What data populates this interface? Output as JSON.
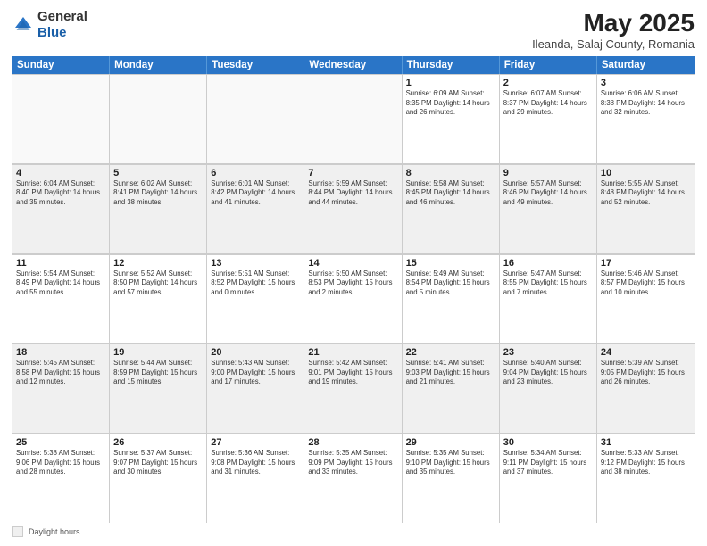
{
  "header": {
    "logo_general": "General",
    "logo_blue": "Blue",
    "title": "May 2025",
    "subtitle": "Ileanda, Salaj County, Romania"
  },
  "calendar": {
    "days_of_week": [
      "Sunday",
      "Monday",
      "Tuesday",
      "Wednesday",
      "Thursday",
      "Friday",
      "Saturday"
    ],
    "weeks": [
      [
        {
          "day": "",
          "info": "",
          "empty": true
        },
        {
          "day": "",
          "info": "",
          "empty": true
        },
        {
          "day": "",
          "info": "",
          "empty": true
        },
        {
          "day": "",
          "info": "",
          "empty": true
        },
        {
          "day": "1",
          "info": "Sunrise: 6:09 AM\nSunset: 8:35 PM\nDaylight: 14 hours and 26 minutes.",
          "empty": false
        },
        {
          "day": "2",
          "info": "Sunrise: 6:07 AM\nSunset: 8:37 PM\nDaylight: 14 hours and 29 minutes.",
          "empty": false
        },
        {
          "day": "3",
          "info": "Sunrise: 6:06 AM\nSunset: 8:38 PM\nDaylight: 14 hours and 32 minutes.",
          "empty": false
        }
      ],
      [
        {
          "day": "4",
          "info": "Sunrise: 6:04 AM\nSunset: 8:40 PM\nDaylight: 14 hours and 35 minutes.",
          "empty": false
        },
        {
          "day": "5",
          "info": "Sunrise: 6:02 AM\nSunset: 8:41 PM\nDaylight: 14 hours and 38 minutes.",
          "empty": false
        },
        {
          "day": "6",
          "info": "Sunrise: 6:01 AM\nSunset: 8:42 PM\nDaylight: 14 hours and 41 minutes.",
          "empty": false
        },
        {
          "day": "7",
          "info": "Sunrise: 5:59 AM\nSunset: 8:44 PM\nDaylight: 14 hours and 44 minutes.",
          "empty": false
        },
        {
          "day": "8",
          "info": "Sunrise: 5:58 AM\nSunset: 8:45 PM\nDaylight: 14 hours and 46 minutes.",
          "empty": false
        },
        {
          "day": "9",
          "info": "Sunrise: 5:57 AM\nSunset: 8:46 PM\nDaylight: 14 hours and 49 minutes.",
          "empty": false
        },
        {
          "day": "10",
          "info": "Sunrise: 5:55 AM\nSunset: 8:48 PM\nDaylight: 14 hours and 52 minutes.",
          "empty": false
        }
      ],
      [
        {
          "day": "11",
          "info": "Sunrise: 5:54 AM\nSunset: 8:49 PM\nDaylight: 14 hours and 55 minutes.",
          "empty": false
        },
        {
          "day": "12",
          "info": "Sunrise: 5:52 AM\nSunset: 8:50 PM\nDaylight: 14 hours and 57 minutes.",
          "empty": false
        },
        {
          "day": "13",
          "info": "Sunrise: 5:51 AM\nSunset: 8:52 PM\nDaylight: 15 hours and 0 minutes.",
          "empty": false
        },
        {
          "day": "14",
          "info": "Sunrise: 5:50 AM\nSunset: 8:53 PM\nDaylight: 15 hours and 2 minutes.",
          "empty": false
        },
        {
          "day": "15",
          "info": "Sunrise: 5:49 AM\nSunset: 8:54 PM\nDaylight: 15 hours and 5 minutes.",
          "empty": false
        },
        {
          "day": "16",
          "info": "Sunrise: 5:47 AM\nSunset: 8:55 PM\nDaylight: 15 hours and 7 minutes.",
          "empty": false
        },
        {
          "day": "17",
          "info": "Sunrise: 5:46 AM\nSunset: 8:57 PM\nDaylight: 15 hours and 10 minutes.",
          "empty": false
        }
      ],
      [
        {
          "day": "18",
          "info": "Sunrise: 5:45 AM\nSunset: 8:58 PM\nDaylight: 15 hours and 12 minutes.",
          "empty": false
        },
        {
          "day": "19",
          "info": "Sunrise: 5:44 AM\nSunset: 8:59 PM\nDaylight: 15 hours and 15 minutes.",
          "empty": false
        },
        {
          "day": "20",
          "info": "Sunrise: 5:43 AM\nSunset: 9:00 PM\nDaylight: 15 hours and 17 minutes.",
          "empty": false
        },
        {
          "day": "21",
          "info": "Sunrise: 5:42 AM\nSunset: 9:01 PM\nDaylight: 15 hours and 19 minutes.",
          "empty": false
        },
        {
          "day": "22",
          "info": "Sunrise: 5:41 AM\nSunset: 9:03 PM\nDaylight: 15 hours and 21 minutes.",
          "empty": false
        },
        {
          "day": "23",
          "info": "Sunrise: 5:40 AM\nSunset: 9:04 PM\nDaylight: 15 hours and 23 minutes.",
          "empty": false
        },
        {
          "day": "24",
          "info": "Sunrise: 5:39 AM\nSunset: 9:05 PM\nDaylight: 15 hours and 26 minutes.",
          "empty": false
        }
      ],
      [
        {
          "day": "25",
          "info": "Sunrise: 5:38 AM\nSunset: 9:06 PM\nDaylight: 15 hours and 28 minutes.",
          "empty": false
        },
        {
          "day": "26",
          "info": "Sunrise: 5:37 AM\nSunset: 9:07 PM\nDaylight: 15 hours and 30 minutes.",
          "empty": false
        },
        {
          "day": "27",
          "info": "Sunrise: 5:36 AM\nSunset: 9:08 PM\nDaylight: 15 hours and 31 minutes.",
          "empty": false
        },
        {
          "day": "28",
          "info": "Sunrise: 5:35 AM\nSunset: 9:09 PM\nDaylight: 15 hours and 33 minutes.",
          "empty": false
        },
        {
          "day": "29",
          "info": "Sunrise: 5:35 AM\nSunset: 9:10 PM\nDaylight: 15 hours and 35 minutes.",
          "empty": false
        },
        {
          "day": "30",
          "info": "Sunrise: 5:34 AM\nSunset: 9:11 PM\nDaylight: 15 hours and 37 minutes.",
          "empty": false
        },
        {
          "day": "31",
          "info": "Sunrise: 5:33 AM\nSunset: 9:12 PM\nDaylight: 15 hours and 38 minutes.",
          "empty": false
        }
      ]
    ],
    "legend_label": "Daylight hours"
  }
}
